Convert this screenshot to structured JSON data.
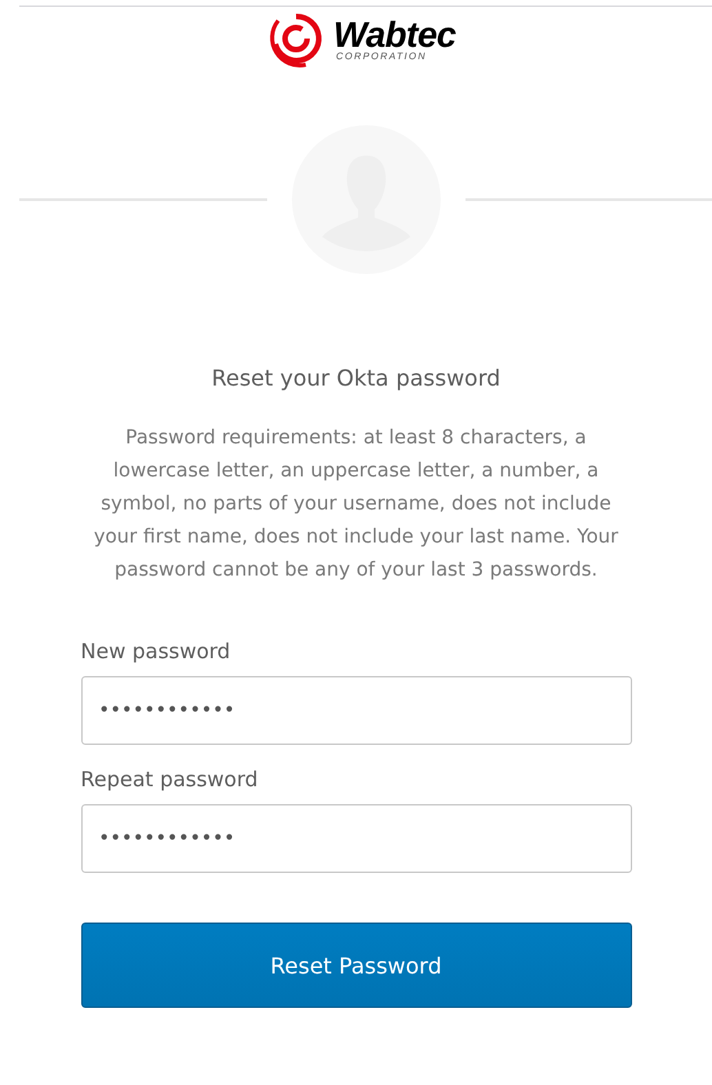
{
  "logo": {
    "name": "Wabtec",
    "subtitle": "CORPORATION"
  },
  "title": "Reset your Okta password",
  "requirements": "Password requirements: at least 8 characters, a lowercase letter, an uppercase letter, a number, a symbol, no parts of your username, does not include your first name, does not include your last name. Your password cannot be any of your last 3 passwords.",
  "fields": [
    {
      "label": "New password",
      "value": "••••••••••••"
    },
    {
      "label": "Repeat password",
      "value": "••••••••••••"
    }
  ],
  "button": "Reset Password"
}
